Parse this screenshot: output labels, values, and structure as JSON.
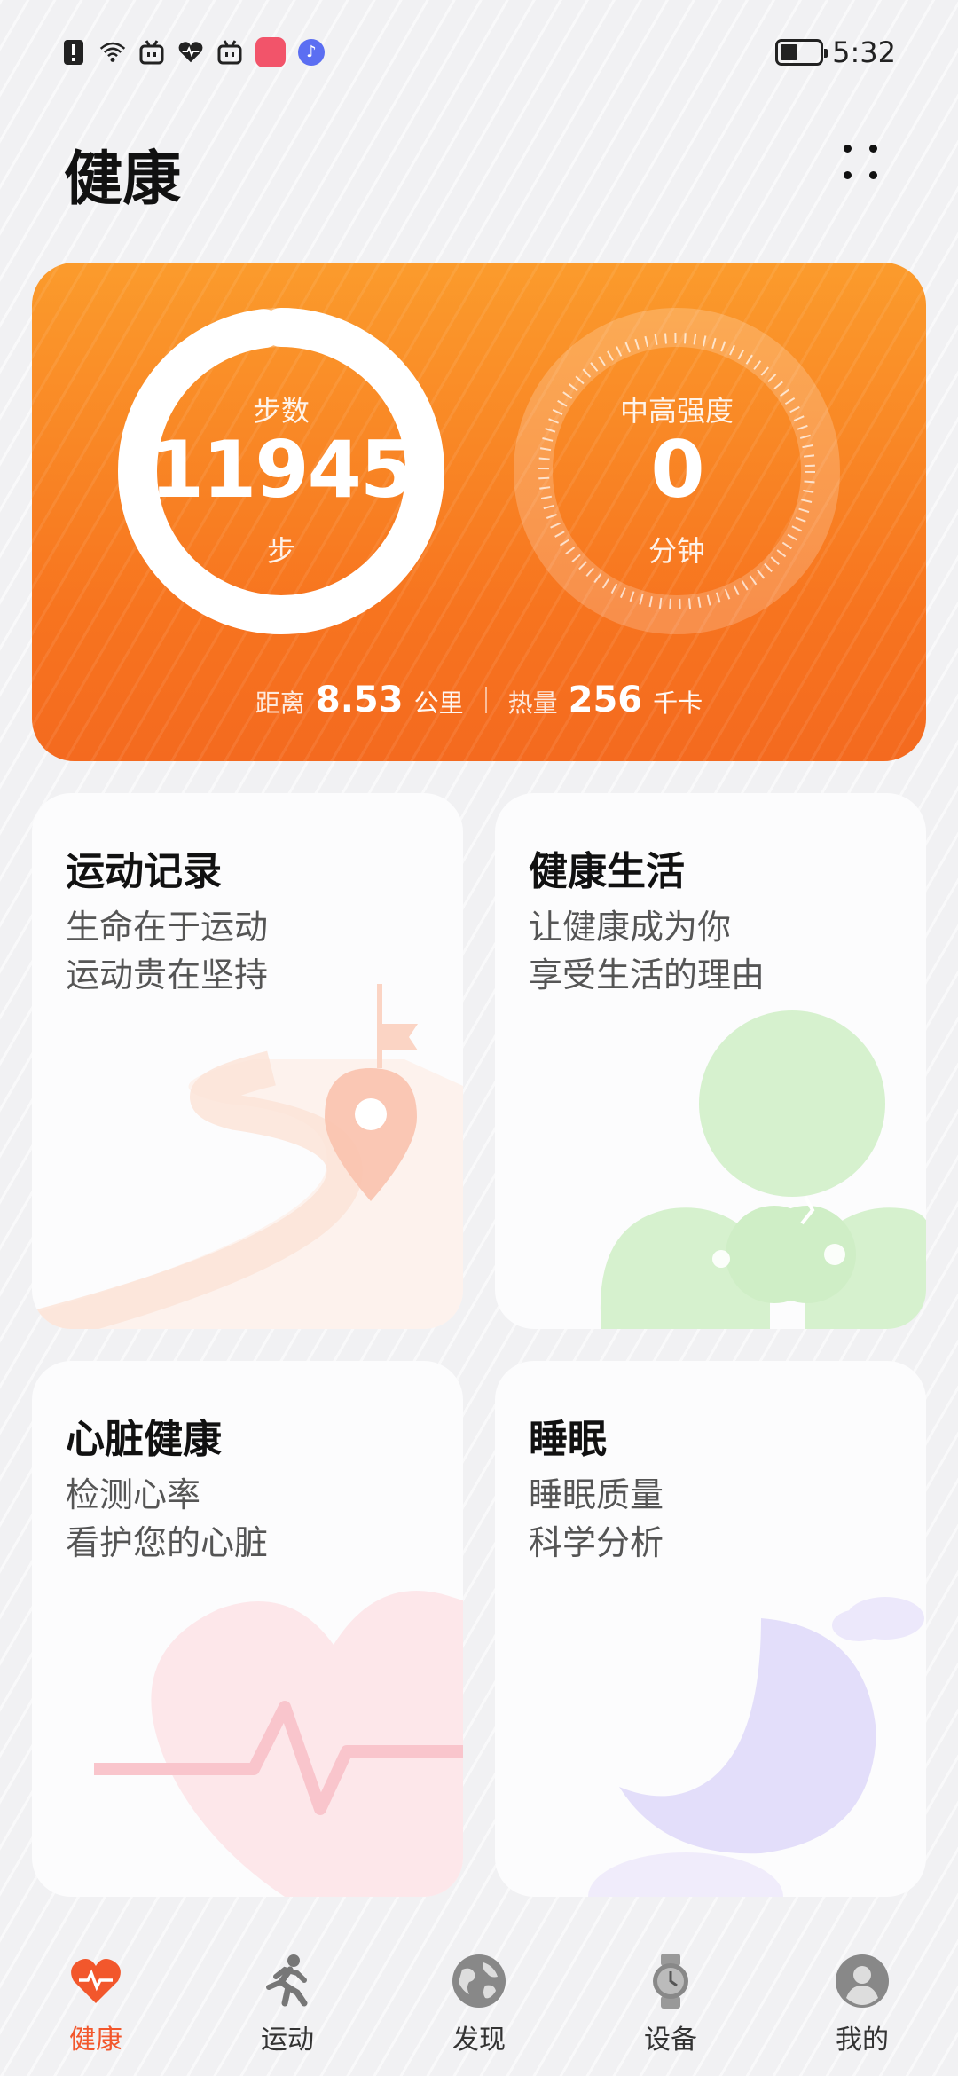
{
  "status_bar": {
    "time": "5:32",
    "icons": [
      "alert-icon",
      "wifi-icon",
      "bilibili-icon",
      "health-icon",
      "bilibili-icon",
      "app-store-icon",
      "music-icon"
    ],
    "battery_level": 0.45
  },
  "header": {
    "title": "健康"
  },
  "summary": {
    "steps": {
      "label": "步数",
      "value": "11945",
      "unit": "步",
      "progress": 0.98
    },
    "intensity": {
      "label": "中高强度",
      "value": "0",
      "unit": "分钟",
      "progress": 0
    },
    "distance": {
      "label": "距离",
      "value": "8.53",
      "unit": "公里"
    },
    "calories": {
      "label": "热量",
      "value": "256",
      "unit": "千卡"
    }
  },
  "tiles": [
    {
      "title": "运动记录",
      "line1": "生命在于运动",
      "line2": "运动贵在坚持",
      "icon": "route-icon"
    },
    {
      "title": "健康生活",
      "line1": "让健康成为你",
      "line2": "享受生活的理由",
      "icon": "clover-icon"
    },
    {
      "title": "心脏健康",
      "line1": "检测心率",
      "line2": "看护您的心脏",
      "icon": "heart-icon"
    },
    {
      "title": "睡眠",
      "line1": "睡眠质量",
      "line2": "科学分析",
      "icon": "moon-icon"
    }
  ],
  "nav": [
    {
      "label": "健康",
      "icon": "heart-pulse-icon",
      "active": true
    },
    {
      "label": "运动",
      "icon": "runner-icon",
      "active": false
    },
    {
      "label": "发现",
      "icon": "globe-icon",
      "active": false
    },
    {
      "label": "设备",
      "icon": "watch-icon",
      "active": false
    },
    {
      "label": "我的",
      "icon": "profile-icon",
      "active": false
    }
  ],
  "colors": {
    "accent": "#f2572c",
    "summary_top": "#fb9b2c",
    "summary_bottom": "#f46a1f"
  }
}
